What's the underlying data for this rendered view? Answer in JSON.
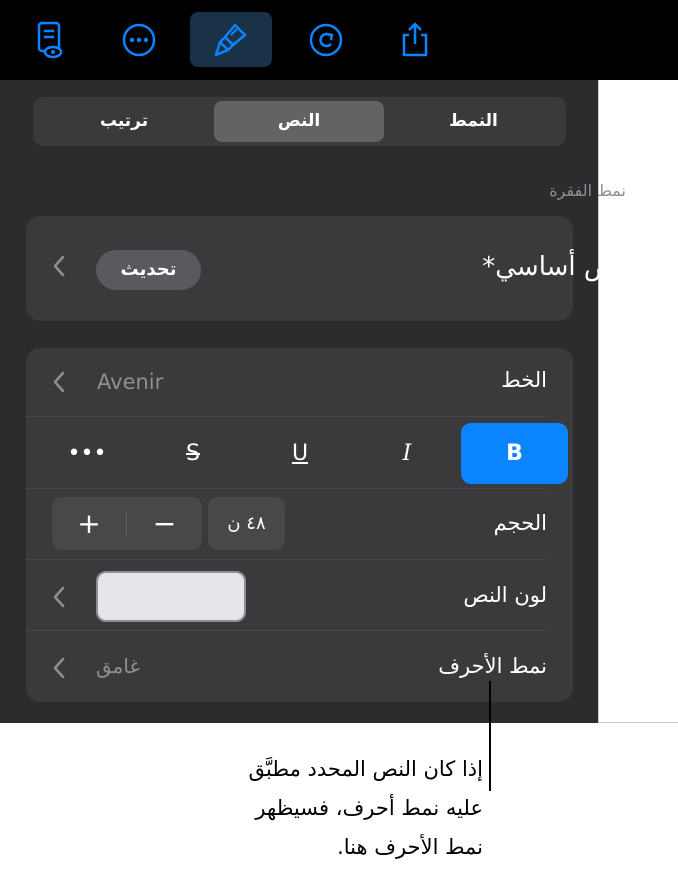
{
  "toolbar": {
    "buttons": [
      {
        "name": "reading-view-icon"
      },
      {
        "name": "more-icon"
      },
      {
        "name": "format-brush-icon",
        "active": true
      },
      {
        "name": "undo-icon"
      },
      {
        "name": "share-icon"
      }
    ],
    "active_color": "#1a3248",
    "icon_color": "#0a84ff"
  },
  "segmented": {
    "items": [
      "النمط",
      "النص",
      "ترتيب"
    ],
    "selected": "النص"
  },
  "paragraph_section": {
    "label": "نمط الفقرة",
    "style_name": "نص أساسي*",
    "update_label": "تحديث"
  },
  "font_row": {
    "label": "الخط",
    "value": "Avenir"
  },
  "style_buttons": {
    "bold": "B",
    "italic": "I",
    "underline": "U",
    "strike": "S",
    "more": "•••"
  },
  "size_row": {
    "label": "الحجم",
    "value": "٤٨ ن",
    "minus": "−",
    "plus": "+"
  },
  "color_row": {
    "label": "لون النص",
    "swatch_color": "#e5e5ea"
  },
  "char_style_row": {
    "label": "نمط الأحرف",
    "value": "غامق"
  },
  "callout": {
    "line1": "إذا كان النص المحدد مطبَّق",
    "line2": "عليه نمط أحرف، فسيظهر",
    "line3": "نمط الأحرف هنا."
  },
  "colors": {
    "panel_bg": "#2c2c2e",
    "card_bg": "#3a3a3c",
    "accent": "#0a84ff"
  }
}
